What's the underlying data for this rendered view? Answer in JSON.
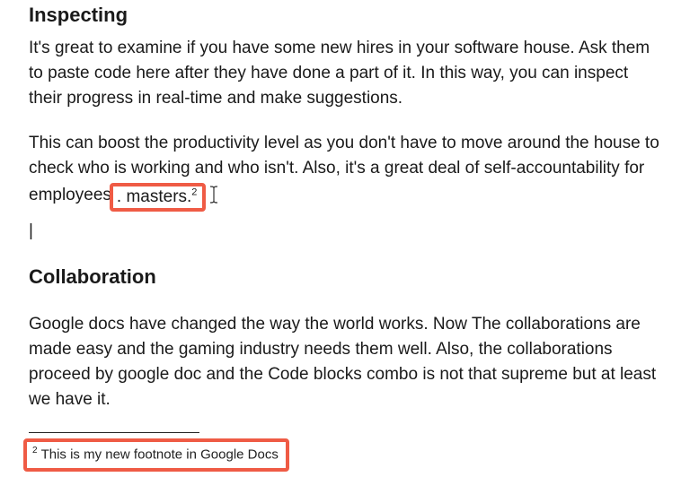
{
  "sections": {
    "inspecting": {
      "heading": "Inspecting",
      "para1": "It's great to examine if you have some new hires in your software house. Ask them to paste code here after they have done a part of it. In this way, you can inspect their progress in real-time and make suggestions.",
      "para2_before": "This can boost the productivity level as you don't have to move around the house to check who is working and who isn't. Also, it's a great deal of self-accountability for employees",
      "para2_box": ". masters.",
      "para2_box_sup": "2"
    },
    "collaboration": {
      "heading": "Collaboration",
      "para1": "Google docs have changed the way the world works. Now The collaborations are made easy and the gaming industry needs them well. Also, the collaborations proceed by google doc and the Code blocks combo is not that supreme but at least we have it."
    }
  },
  "footnote": {
    "number": "2",
    "text": "This is my new footnote in Google Docs"
  },
  "caret": "|",
  "highlight_color": "#ef5b45"
}
